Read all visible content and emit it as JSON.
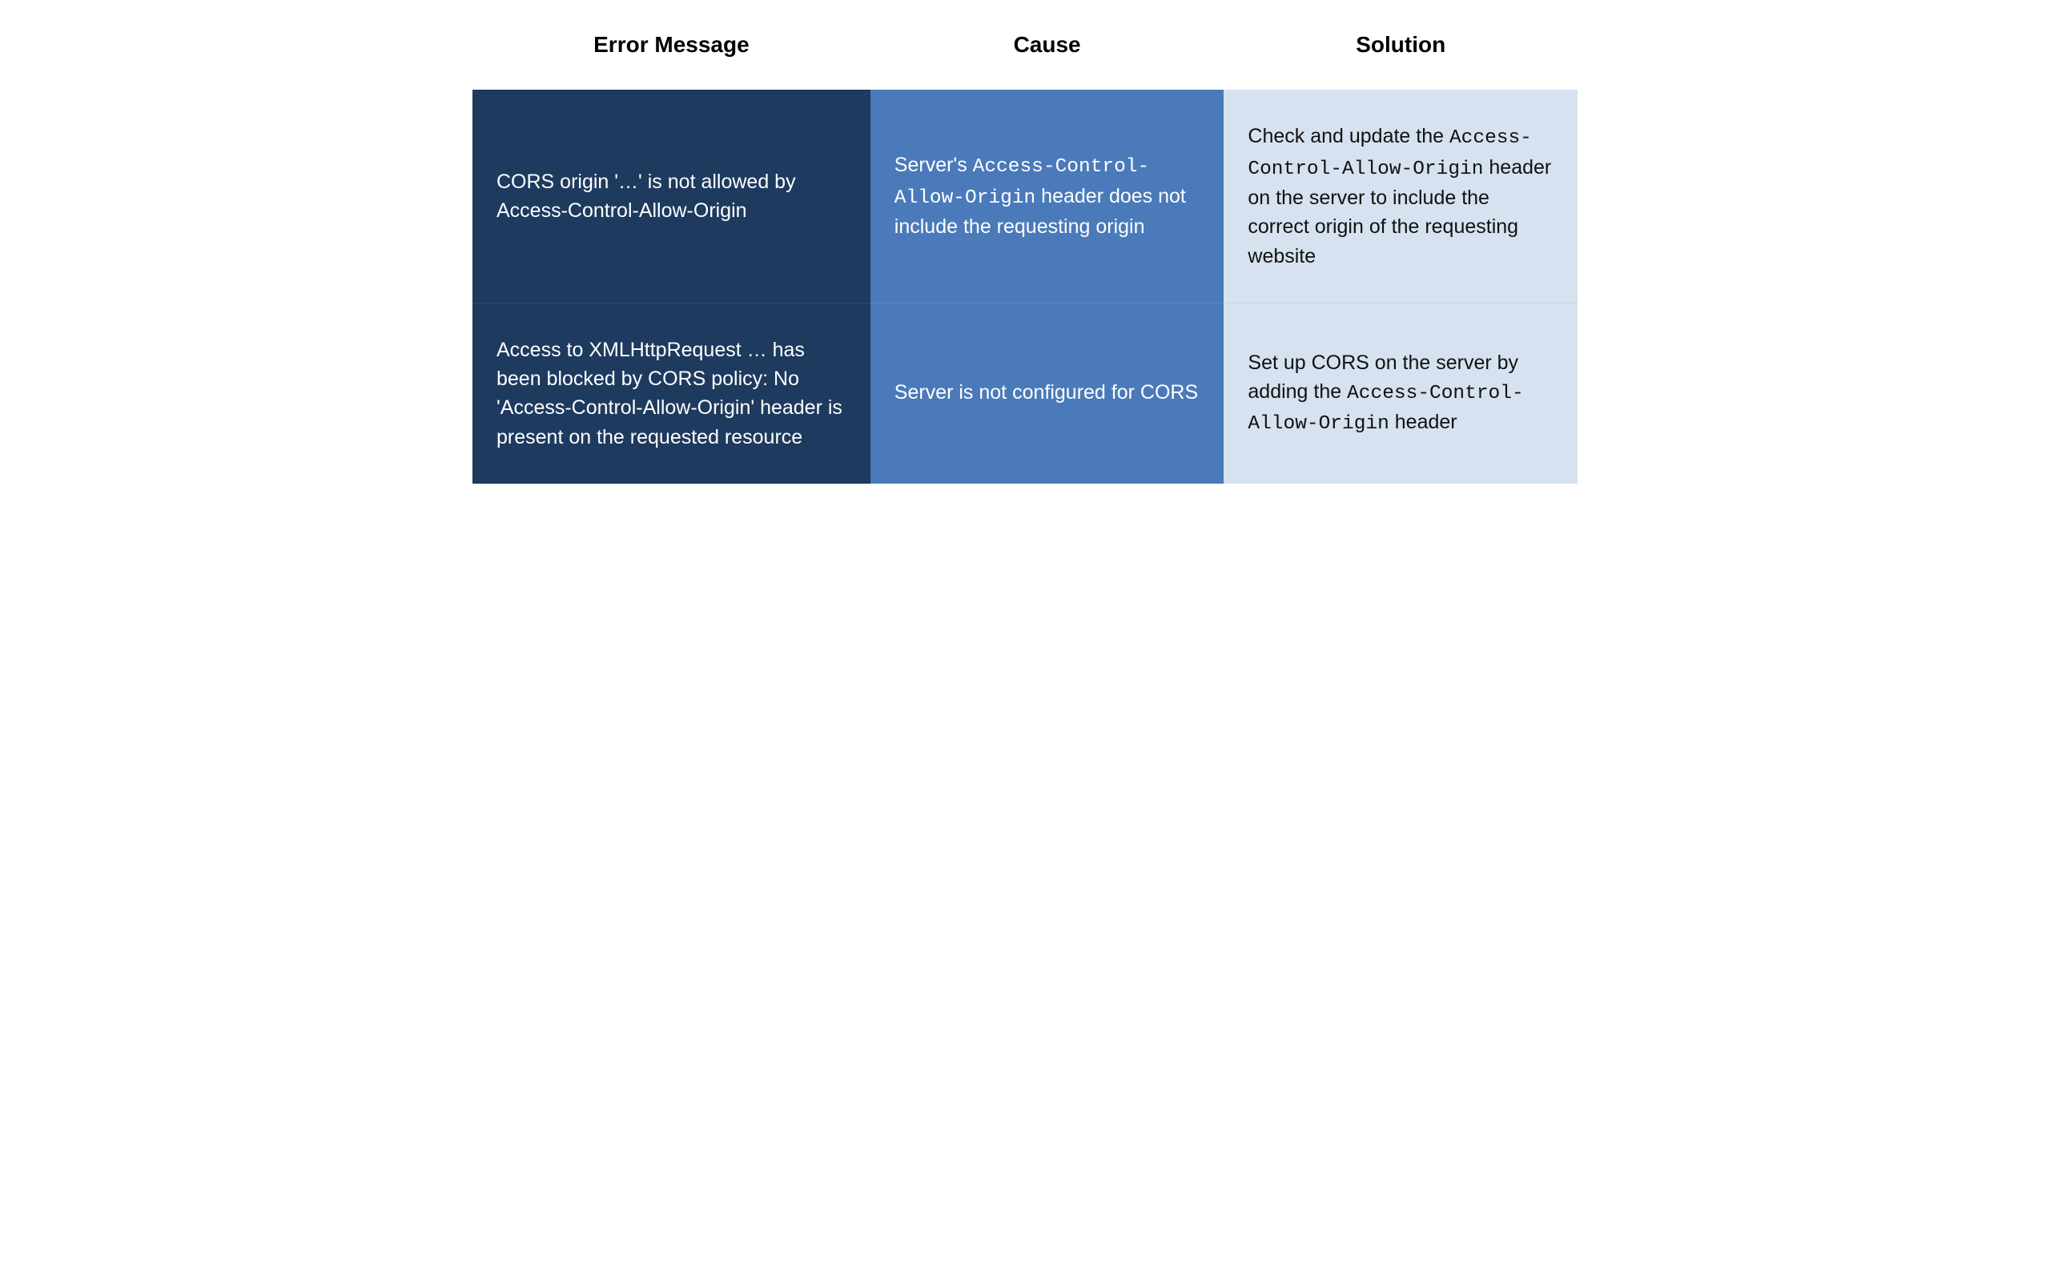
{
  "table": {
    "headers": {
      "error": "Error Message",
      "cause": "Cause",
      "solution": "Solution"
    },
    "rows": [
      {
        "error_text": "CORS origin '…' is not allowed by Access-Control-Allow-Origin",
        "cause_pre": "Server's ",
        "cause_code": "Access-Control-Allow-Origin",
        "cause_post": " header does not include the requesting origin",
        "soln_pre": "Check and update the ",
        "soln_code": "Access-Control-Allow-Origin",
        "soln_post": " header on the server to include the correct origin of the requesting website"
      },
      {
        "error_text": "Access to XMLHttpRequest … has been blocked by CORS policy: No 'Access-Control-Allow-Origin' header is present on the requested resource",
        "cause_pre": "Server is not configured for CORS",
        "cause_code": "",
        "cause_post": "",
        "soln_pre": "Set up CORS on the server by adding the ",
        "soln_code": "Access-Control-Allow-Origin",
        "soln_post": " header"
      }
    ]
  }
}
